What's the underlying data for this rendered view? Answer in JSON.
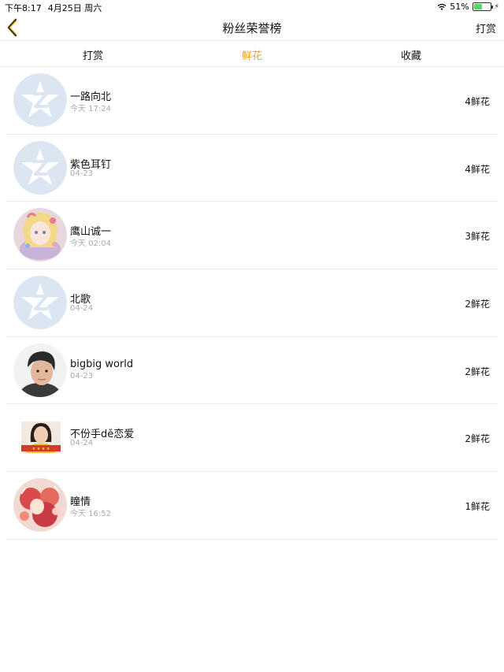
{
  "status_bar": {
    "time": "下午8:17",
    "date": "4月25日 周六",
    "battery": "51%",
    "battery_level": 0.51
  },
  "nav": {
    "title": "粉丝荣誉榜",
    "right_label": "打赏",
    "accent_color": "#f0a12e"
  },
  "tabs": [
    {
      "label": "打赏",
      "active": false
    },
    {
      "label": "鲜花",
      "active": true
    },
    {
      "label": "收藏",
      "active": false
    }
  ],
  "fans": [
    {
      "name": "一路向北",
      "time": "今天 17:24",
      "count": "4鲜花",
      "avatar": "default-qq-avatar"
    },
    {
      "name": "紫色耳钉",
      "time": "04-23",
      "count": "4鲜花",
      "avatar": "default-qq-avatar"
    },
    {
      "name": "鹰山诚一",
      "time": "今天 02:04",
      "count": "3鲜花",
      "avatar": "anime-girl-photo"
    },
    {
      "name": "北歌",
      "time": "04-24",
      "count": "2鲜花",
      "avatar": "default-qq-avatar"
    },
    {
      "name": "bigbig world",
      "time": "04-23",
      "count": "2鲜花",
      "avatar": "man-portrait-photo"
    },
    {
      "name": "不份手dě恋爱",
      "time": "04-24",
      "count": "2鲜花",
      "avatar": "girl-portrait-photo"
    },
    {
      "name": "瞳情",
      "time": "今天 16:52",
      "count": "1鲜花",
      "avatar": "red-anime-photo"
    }
  ]
}
